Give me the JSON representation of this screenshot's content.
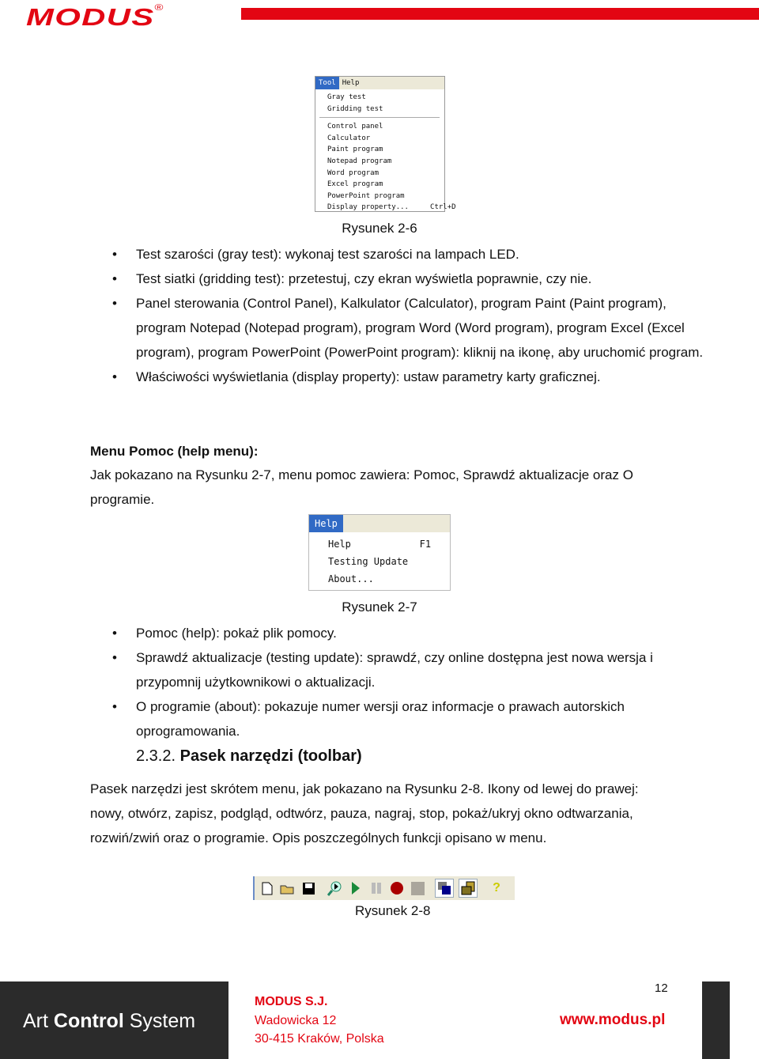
{
  "header": {
    "logo": "MODUS",
    "reg": "®"
  },
  "fig6": {
    "menubar": [
      "Tool",
      "Help"
    ],
    "items": [
      "Gray test",
      "Gridding test",
      "Control panel",
      "Calculator",
      "Paint program",
      "Notepad program",
      "Word program",
      "Excel program",
      "PowerPoint program",
      "Display property...     Ctrl+D"
    ],
    "caption": "Rysunek 2-6"
  },
  "bullets1": [
    "Test szarości (gray test): wykonaj test szarości na lampach LED.",
    "Test siatki (gridding test): przetestuj, czy ekran wyświetla poprawnie, czy nie.",
    "Panel sterowania (Control Panel), Kalkulator (Calculator), program Paint (Paint program), program Notepad (Notepad program), program Word (Word program), program Excel (Excel program), program PowerPoint (PowerPoint program): kliknij na ikonę, aby uruchomić program.",
    "Właściwości wyświetlania (display property): ustaw parametry karty graficznej."
  ],
  "help_heading": "Menu Pomoc (help menu):",
  "help_intro": "Jak pokazano na Rysunku 2-7, menu pomoc zawiera: Pomoc, Sprawdź aktualizacje oraz O programie.",
  "fig7": {
    "menubar": "Help",
    "items": [
      "Help            F1",
      "Testing Update",
      "About..."
    ],
    "caption": "Rysunek 2-7"
  },
  "bullets2": [
    "Pomoc (help): pokaż plik pomocy.",
    "Sprawdź aktualizacje (testing update): sprawdź, czy online dostępna jest nowa wersja i przypomnij użytkownikowi o aktualizacji.",
    "O programie (about): pokazuje numer wersji oraz informacje o prawach autorskich oprogramowania."
  ],
  "section": {
    "number": "2.3.2.",
    "title": "Pasek narzędzi (toolbar)"
  },
  "toolbar_text": "Pasek narzędzi jest skrótem menu, jak pokazano na Rysunku 2-8. Ikony od lewej do prawej: nowy, otwórz, zapisz, podgląd, odtwórz, pauza, nagraj, stop, pokaż/ukryj okno odtwarzania, rozwiń/zwiń oraz o programie. Opis poszczególnych funkcji opisano w menu.",
  "fig8": {
    "icons": [
      "new-icon",
      "open-icon",
      "save-icon",
      "preview-icon",
      "play-icon",
      "pause-icon",
      "record-icon",
      "stop-icon",
      "show-hide-window-icon",
      "expand-collapse-icon",
      "about-icon"
    ],
    "caption": "Rysunek 2-8"
  },
  "footer": {
    "brand_light1": "Art ",
    "brand_bold": "Control",
    "brand_light2": " System",
    "company": "MODUS S.J.",
    "street": "Wadowicka 12",
    "city": "30-415 Kraków, Polska",
    "page": "12",
    "url": "www.modus.pl"
  }
}
